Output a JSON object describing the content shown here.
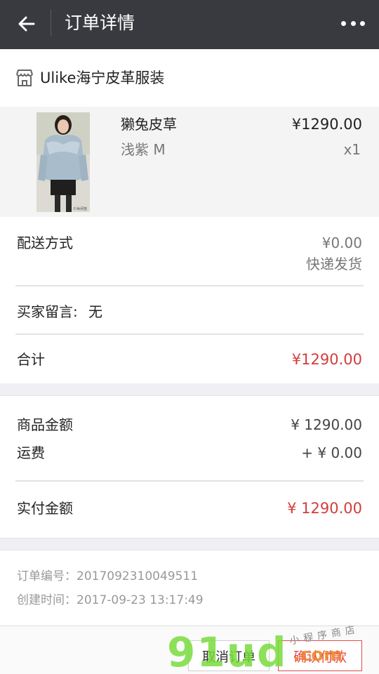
{
  "header": {
    "title": "订单详情",
    "back_icon": "back-arrow-icon",
    "more_icon": "more-dots-icon"
  },
  "shop": {
    "icon": "shop-icon",
    "name": "Ulike海宁皮革服装"
  },
  "product": {
    "name": "獭兔皮草",
    "spec": "浅紫 M",
    "price": "¥1290.00",
    "qty": "x1",
    "image_watermark": "©休闲馆"
  },
  "delivery": {
    "label": "配送方式",
    "fee": "¥0.00",
    "method": "快递发货"
  },
  "message": {
    "label": "买家留言:",
    "value": "无"
  },
  "total": {
    "label": "合计",
    "value": "¥1290.00"
  },
  "summary": {
    "goods_label": "商品金额",
    "goods_value": "¥ 1290.00",
    "shipping_label": "运费",
    "shipping_value": "+ ¥ 0.00",
    "paid_label": "实付金额",
    "paid_value": "¥ 1290.00"
  },
  "meta": {
    "order_no": "订单编号：2017092310049511",
    "created_at": "创建时间：2017-09-23 13:17:49"
  },
  "footer": {
    "cancel_label": "取消订单",
    "pay_label": "确认付款"
  },
  "watermark": {
    "logo": "91ud",
    "domain": ".com",
    "caption": "小程序商店"
  },
  "colors": {
    "header_bg": "#393a3f",
    "accent_red": "#d33d3d",
    "page_bg": "#efeff4"
  }
}
